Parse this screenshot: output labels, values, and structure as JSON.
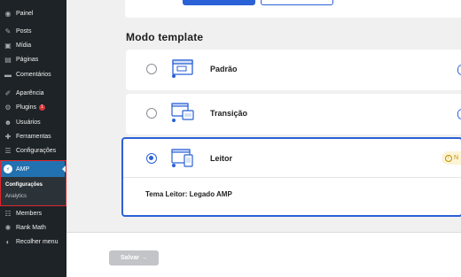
{
  "sidebar": {
    "items": [
      {
        "label": "Painel",
        "icon": "dashboard-icon"
      },
      {
        "label": "Posts",
        "icon": "pin-icon"
      },
      {
        "label": "Mídia",
        "icon": "media-icon"
      },
      {
        "label": "Páginas",
        "icon": "pages-icon"
      },
      {
        "label": "Comentários",
        "icon": "comments-icon"
      },
      {
        "label": "Aparência",
        "icon": "brush-icon"
      },
      {
        "label": "Plugins",
        "icon": "plugin-icon",
        "badge": "1"
      },
      {
        "label": "Usuários",
        "icon": "users-icon"
      },
      {
        "label": "Ferramentas",
        "icon": "wrench-icon"
      },
      {
        "label": "Configurações",
        "icon": "settings-icon"
      }
    ],
    "amp": {
      "label": "AMP",
      "icon": "amp-icon",
      "submenu": [
        "Configurações",
        "Analytics"
      ]
    },
    "bottom_items": [
      {
        "label": "Members",
        "icon": "members-icon"
      },
      {
        "label": "Rank Math",
        "icon": "rankmath-icon"
      },
      {
        "label": "Recolher menu",
        "icon": "collapse-icon"
      }
    ]
  },
  "main": {
    "section_title": "Modo template",
    "options": [
      {
        "label": "Padrão",
        "selected": false
      },
      {
        "label": "Transição",
        "selected": false
      },
      {
        "label": "Leitor",
        "selected": true
      }
    ],
    "reader_theme": "Tema Leitor: Legado AMP",
    "save_label": "Salvar →"
  },
  "colors": {
    "accent": "#2b61d6",
    "sidebar_bg": "#1d2327",
    "amp_active": "#2271b1",
    "highlight_border": "#e0252d"
  }
}
